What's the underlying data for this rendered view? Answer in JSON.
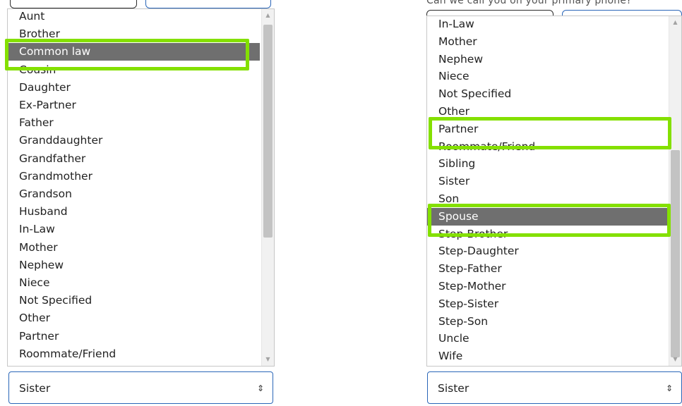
{
  "left_panel": {
    "options": [
      "Aunt",
      "Brother",
      "Common law",
      "Cousin",
      "Daughter",
      "Ex-Partner",
      "Father",
      "Granddaughter",
      "Grandfather",
      "Grandmother",
      "Grandson",
      "Husband",
      "In-Law",
      "Mother",
      "Nephew",
      "Niece",
      "Not Specified",
      "Other",
      "Partner",
      "Roommate/Friend"
    ],
    "selected_option": "Common law",
    "scroll": {
      "up_icon": "▲",
      "down_icon": "▼"
    },
    "select": {
      "value": "Sister",
      "arrow_icon": "⇕"
    }
  },
  "right_panel": {
    "cut_off_text": "Can we call you on your primary phone?",
    "options": [
      "In-Law",
      "Mother",
      "Nephew",
      "Niece",
      "Not Specified",
      "Other",
      "Partner",
      "Roommate/Friend",
      "Sibling",
      "Sister",
      "Son",
      "Spouse",
      "Step-Brother",
      "Step-Daughter",
      "Step-Father",
      "Step-Mother",
      "Step-Sister",
      "Step-Son",
      "Uncle",
      "Wife"
    ],
    "selected_option": "Spouse",
    "scroll": {
      "up_icon": "▲",
      "down_icon": "▼"
    },
    "select": {
      "value": "Sister",
      "arrow_icon": "⇕"
    }
  },
  "colors": {
    "highlight": "#84e000",
    "selected_background": "#6f6f6f",
    "select_border": "#2a66b8"
  }
}
